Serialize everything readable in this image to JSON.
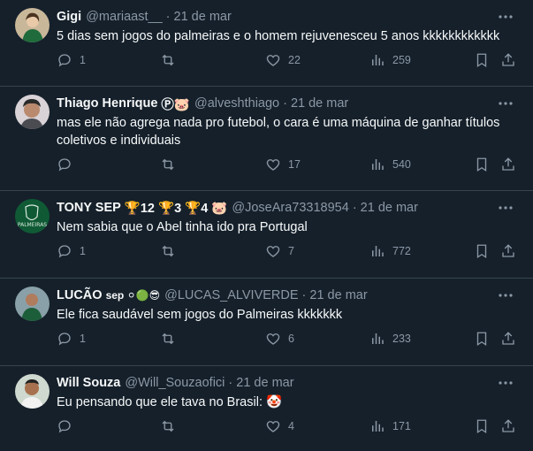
{
  "tweets": [
    {
      "name": "Gigi",
      "badges": "",
      "handle": "@mariaast__",
      "date": "21 de mar",
      "text": "5 dias sem jogos do palmeiras e o homem rejuvenesceu 5 anos kkkkkkkkkkkk",
      "replies": "1",
      "retweets": "",
      "likes": "22",
      "views": "259"
    },
    {
      "name": "Thiago Henrique",
      "badges": "Ⓟ🐷",
      "handle": "@alveshthiago",
      "date": "21 de mar",
      "text": "mas ele não agrega nada pro futebol, o cara é uma máquina de ganhar títulos coletivos e individuais",
      "replies": "",
      "retweets": "",
      "likes": "17",
      "views": "540"
    },
    {
      "name": "TONY SEP",
      "badges": "🏆12 🏆3 🏆4 🐷",
      "handle": "@JoseAra73318954",
      "date": "21 de mar",
      "text": "Nem sabia que o Abel tinha ido pra Portugal",
      "replies": "1",
      "retweets": "",
      "likes": "7",
      "views": "772"
    },
    {
      "name": "LUCÃO",
      "badges": "sep ⚪🟢😎",
      "handle": "@LUCAS_ALVIVERDE",
      "date": "21 de mar",
      "text": "Ele fica saudável sem jogos do Palmeiras kkkkkkk",
      "replies": "1",
      "retweets": "",
      "likes": "6",
      "views": "233"
    },
    {
      "name": "Will Souza",
      "badges": "",
      "handle": "@Will_Souzaofici",
      "date": "21 de mar",
      "text": "Eu pensando que ele tava no Brasil: 🤡",
      "replies": "",
      "retweets": "",
      "likes": "4",
      "views": "171"
    }
  ],
  "colors": {
    "background": "#15202b",
    "divider": "#38444d",
    "secondary_text": "#8b98a5",
    "primary_text": "#f7f9f9"
  }
}
